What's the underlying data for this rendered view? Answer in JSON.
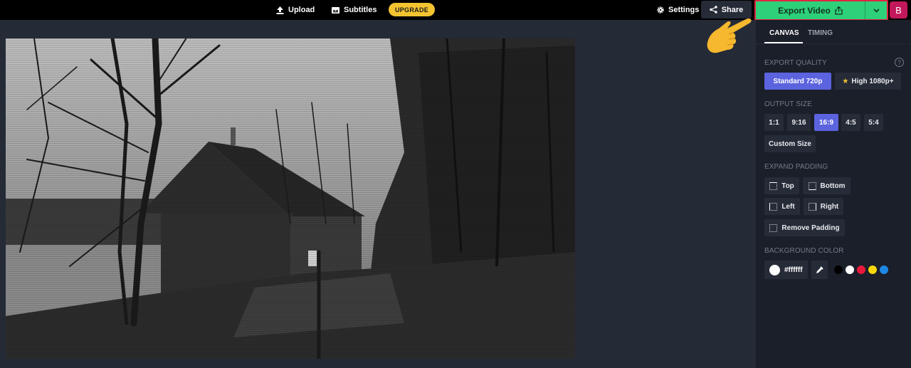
{
  "topbar": {
    "upload_label": "Upload",
    "subtitles_label": "Subtitles",
    "upgrade_label": "UPGRADE",
    "settings_label": "Settings",
    "share_label": "Share",
    "export_label": "Export Video",
    "avatar_initial": "B"
  },
  "colors": {
    "accent": "#5b63de",
    "export_green": "#2ed07a",
    "upgrade_yellow": "#f4c430",
    "avatar_pink": "#c2185b",
    "highlight_red": "#e0243f"
  },
  "panel": {
    "tabs": [
      {
        "label": "CANVAS",
        "active": true
      },
      {
        "label": "TIMING",
        "active": false
      }
    ],
    "export_quality": {
      "label": "EXPORT QUALITY",
      "help_icon": "?",
      "options": [
        {
          "label": "Standard 720p",
          "selected": true
        },
        {
          "label": "High 1080p+",
          "selected": false,
          "icon": "star-icon"
        }
      ]
    },
    "output_size": {
      "label": "OUTPUT SIZE",
      "options": [
        {
          "label": "1:1",
          "selected": false
        },
        {
          "label": "9:16",
          "selected": false
        },
        {
          "label": "16:9",
          "selected": true
        },
        {
          "label": "4:5",
          "selected": false
        },
        {
          "label": "5:4",
          "selected": false
        }
      ],
      "custom_label": "Custom Size"
    },
    "expand_padding": {
      "label": "EXPAND PADDING",
      "options": [
        "Top",
        "Bottom",
        "Left",
        "Right"
      ],
      "remove_label": "Remove Padding"
    },
    "background_color": {
      "label": "BACKGROUND COLOR",
      "current_hex": "#ffffff",
      "presets": [
        "#000000",
        "#ffffff",
        "#e8193c",
        "#f7d708",
        "#1e88e5"
      ]
    }
  }
}
